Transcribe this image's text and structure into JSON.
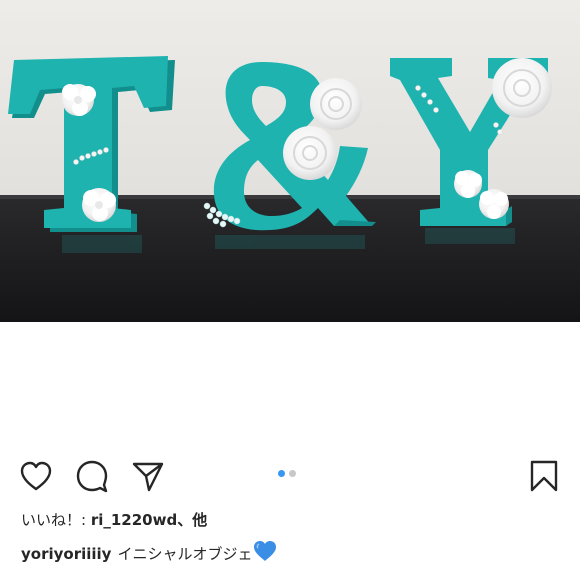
{
  "post": {
    "image_alt": "T & Y initial objects decorated with white flowers",
    "photo_letters": [
      "T",
      "&",
      "Y"
    ],
    "accent_color": "#1fb3b0",
    "carousel": {
      "count": 2,
      "active_index": 0
    }
  },
  "actions": {
    "like_icon": "heart-outline-icon",
    "comment_icon": "comment-bubble-icon",
    "share_icon": "paper-plane-icon",
    "save_icon": "bookmark-outline-icon"
  },
  "likes": {
    "prefix": "いいね！: ",
    "user": "ri_1220wd",
    "suffix": "、他"
  },
  "caption": {
    "username": "yoriyoriiiiy",
    "text": "イニシャルオブジェ",
    "emoji_icon": "blue-heart-icon",
    "emoji_color": "#3b8ee6"
  }
}
